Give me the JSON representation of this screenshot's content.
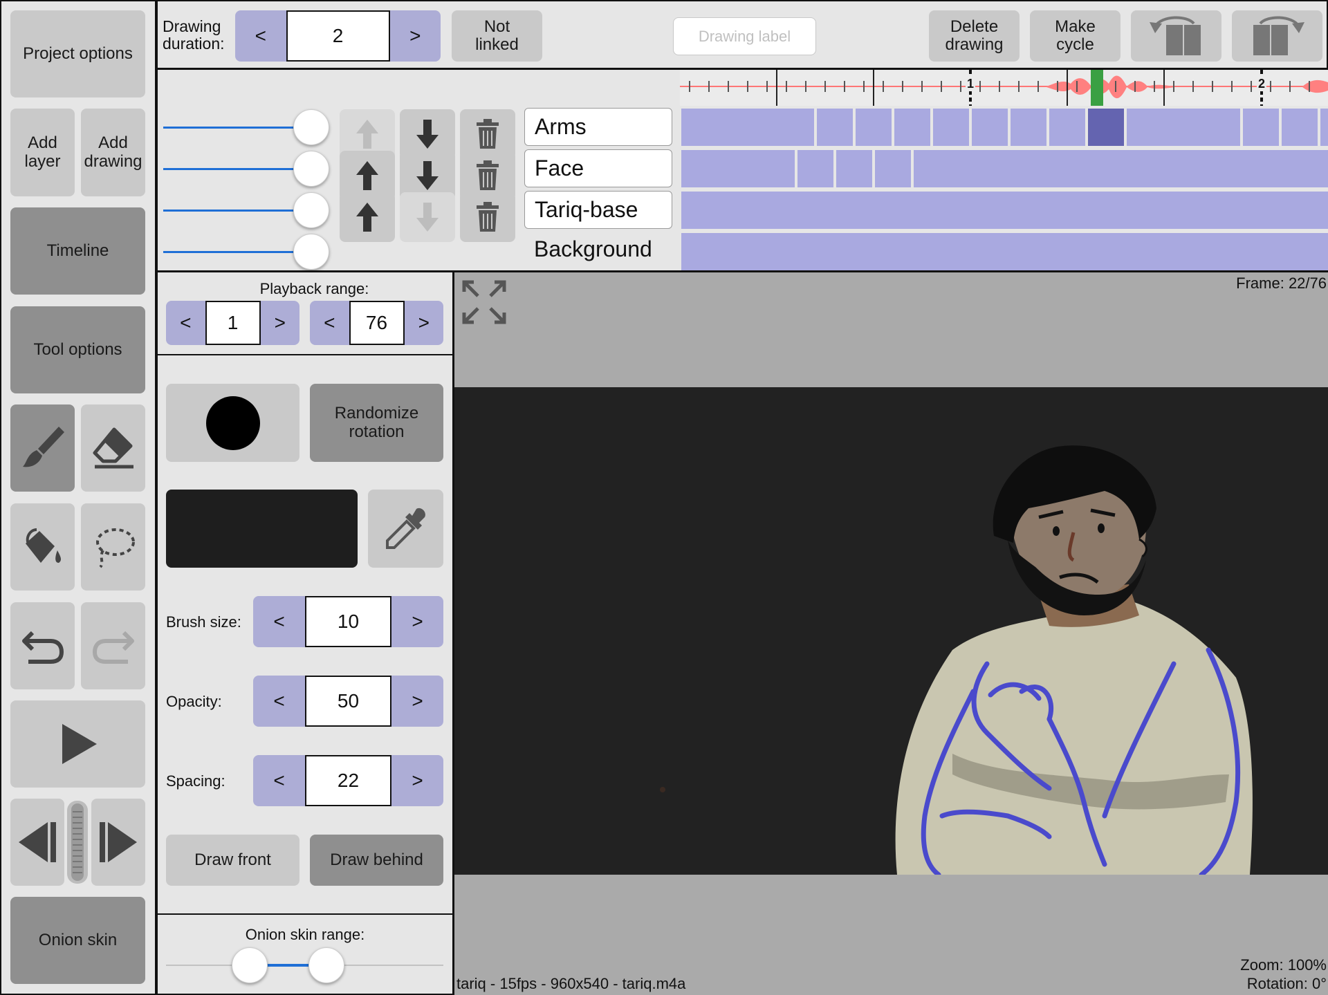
{
  "sidebar": {
    "project_options": "Project options",
    "add_layer": "Add layer",
    "add_drawing": "Add drawing",
    "timeline": "Timeline",
    "tool_options": "Tool options",
    "onion_skin": "Onion skin",
    "tools": [
      "brush-icon",
      "eraser-icon",
      "fill-bucket-icon",
      "lasso-icon",
      "undo-icon",
      "redo-icon",
      "play-icon",
      "step-back-icon",
      "scrubber-icon",
      "step-forward-icon"
    ]
  },
  "toolbar": {
    "drawing_duration_label": "Drawing duration:",
    "duration_value": "2",
    "dec": "<",
    "inc": ">",
    "not_linked": "Not linked",
    "drawing_label_placeholder": "Drawing label",
    "delete_drawing": "Delete drawing",
    "make_cycle": "Make cycle"
  },
  "layers": [
    {
      "name": "Arms"
    },
    {
      "name": "Face"
    },
    {
      "name": "Tariq-base"
    },
    {
      "name": "Background"
    }
  ],
  "timeline": {
    "markers": [
      "1",
      "2"
    ],
    "waveform_color": "#ff6b6b",
    "playhead_color": "#3aa043",
    "cell_color": "#a9a9e0",
    "selected_cell_color": "#6464b0"
  },
  "tool_options": {
    "playback_range_label": "Playback range:",
    "range_start": "1",
    "range_end": "76",
    "randomize_rotation": "Randomize rotation",
    "brush_color": "#1e1e1e",
    "brush_size_label": "Brush size:",
    "brush_size": "10",
    "opacity_label": "Opacity:",
    "opacity": "50",
    "spacing_label": "Spacing:",
    "spacing": "22",
    "draw_front": "Draw front",
    "draw_behind": "Draw behind",
    "onion_skin_range_label": "Onion skin range:"
  },
  "canvas": {
    "frame": "Frame: 22/76",
    "info": "tariq - 15fps - 960x540 - tariq.m4a",
    "zoom": "Zoom: 100%",
    "rotation": "Rotation: 0°"
  }
}
